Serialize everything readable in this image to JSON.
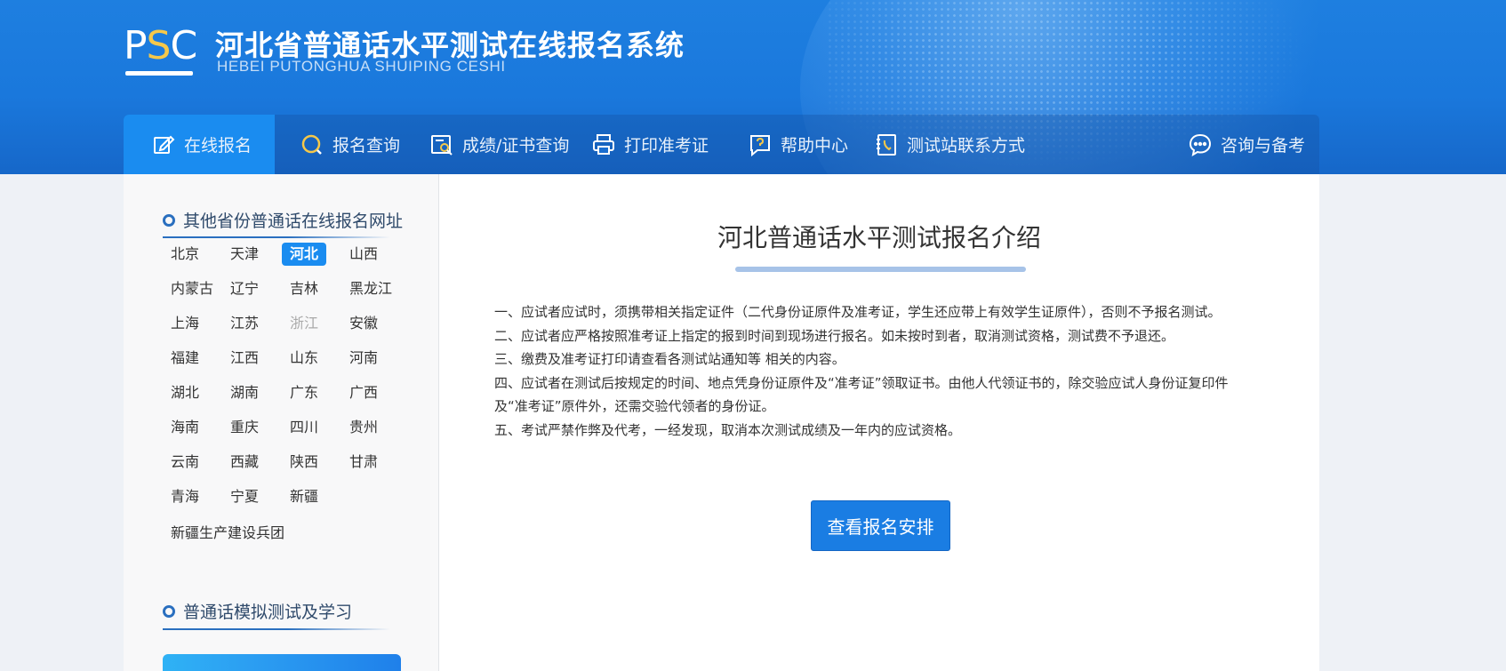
{
  "header": {
    "logo_text_p": "P",
    "logo_text_s": "S",
    "logo_text_c": "C",
    "title": "河北省普通话水平测试在线报名系统",
    "subtitle": "HEBEI PUTONGHUA SHUIPING CESHI"
  },
  "nav": {
    "items": [
      {
        "label": "在线报名",
        "icon": "edit-icon"
      },
      {
        "label": "报名查询",
        "icon": "search-icon"
      },
      {
        "label": "成绩/证书查询",
        "icon": "certificate-search-icon"
      },
      {
        "label": "打印准考证",
        "icon": "printer-icon"
      },
      {
        "label": "帮助中心",
        "icon": "help-icon"
      },
      {
        "label": "测试站联系方式",
        "icon": "phone-book-icon"
      },
      {
        "label": "咨询与备考",
        "icon": "chat-icon"
      }
    ]
  },
  "sidebar": {
    "provinces_title": "其他省份普通话在线报名网址",
    "provinces": [
      "北京",
      "天津",
      "河北",
      "山西",
      "内蒙古",
      "辽宁",
      "吉林",
      "黑龙江",
      "上海",
      "江苏",
      "浙江",
      "安徽",
      "福建",
      "江西",
      "山东",
      "河南",
      "湖北",
      "湖南",
      "广东",
      "广西",
      "海南",
      "重庆",
      "四川",
      "贵州",
      "云南",
      "西藏",
      "陕西",
      "甘肃",
      "青海",
      "宁夏",
      "新疆",
      "新疆生产建设兵团"
    ],
    "active_province": "河北",
    "disabled_province": "浙江",
    "practice_title": "普通话模拟测试及学习"
  },
  "main": {
    "title": "河北普通话水平测试报名介绍",
    "notices": [
      "一、应试者应试时，须携带相关指定证件（二代身份证原件及准考证，学生还应带上有效学生证原件），否则不予报名测试。",
      "二、应试者应严格按照准考证上指定的报到时间到现场进行报名。如未按时到者，取消测试资格，测试费不予退还。",
      "三、缴费及准考证打印请查看各测试站通知等 相关的内容。",
      "四、应试者在测试后按规定的时间、地点凭身份证原件及“准考证”领取证书。由他人代领证书的，除交验应试人身份证复印件",
      "及“准考证”原件外，还需交验代领者的身份证。",
      "五、考试严禁作弊及代考，一经发现，取消本次测试成绩及一年内的应试资格。"
    ],
    "button_label": "查看报名安排"
  },
  "colors": {
    "header_blue": "#1e7fe0",
    "nav_active": "#1a8cf0",
    "button_blue": "#1a7de3",
    "logo_accent": "#f5c84a"
  }
}
